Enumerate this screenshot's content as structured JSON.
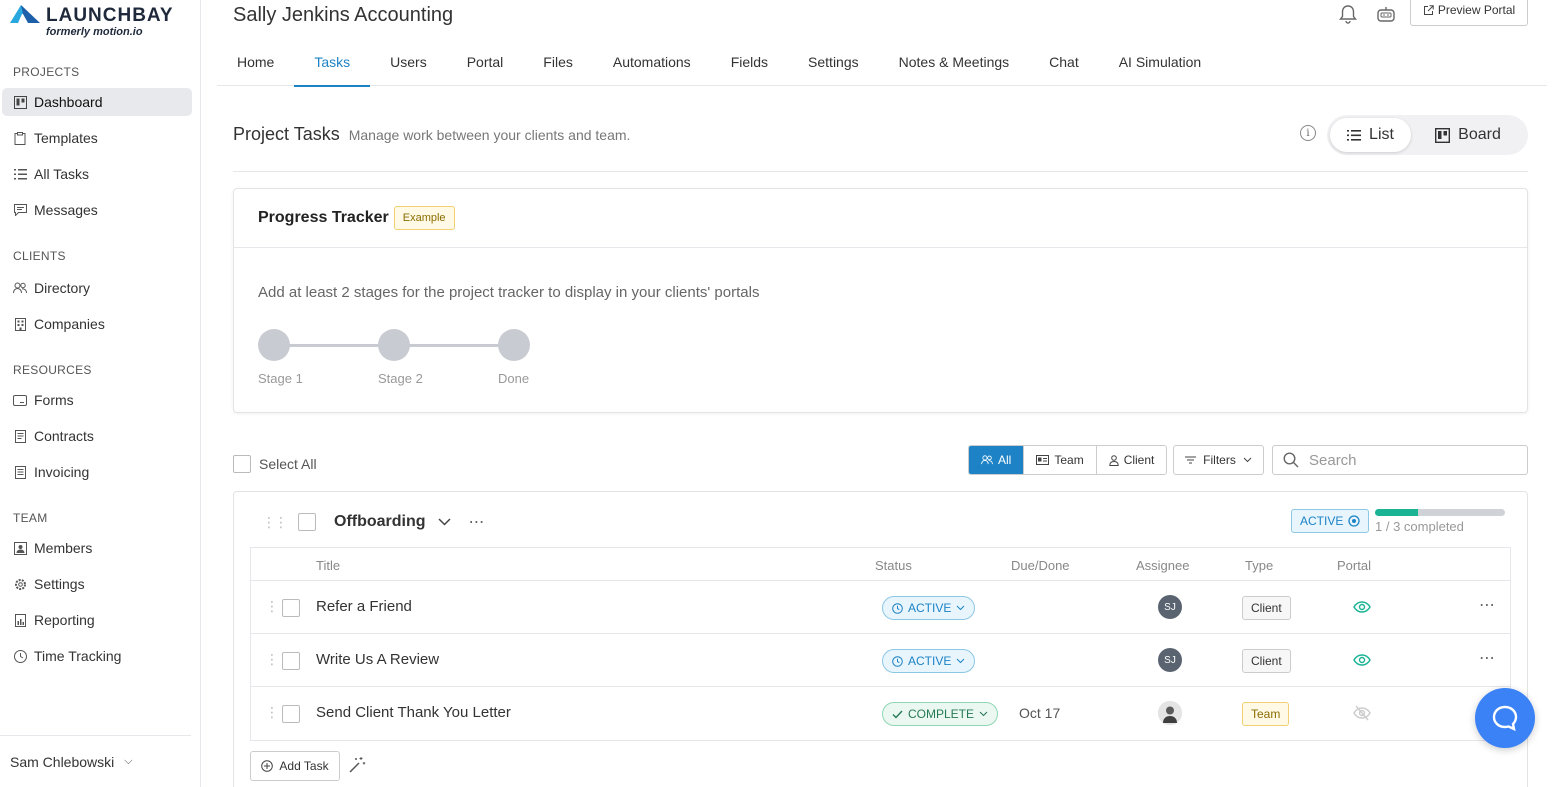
{
  "brand": {
    "name": "LAUNCHBAY",
    "sub": "formerly motion.io"
  },
  "sidebar": {
    "sections": [
      {
        "label": "PROJECTS",
        "items": [
          {
            "label": "Dashboard",
            "icon": "board-icon",
            "active": true
          },
          {
            "label": "Templates",
            "icon": "clipboard-icon"
          },
          {
            "label": "All Tasks",
            "icon": "list-icon"
          },
          {
            "label": "Messages",
            "icon": "message-icon"
          }
        ]
      },
      {
        "label": "CLIENTS",
        "items": [
          {
            "label": "Directory",
            "icon": "users-icon"
          },
          {
            "label": "Companies",
            "icon": "building-icon"
          }
        ]
      },
      {
        "label": "RESOURCES",
        "items": [
          {
            "label": "Forms",
            "icon": "form-icon"
          },
          {
            "label": "Contracts",
            "icon": "document-icon"
          },
          {
            "label": "Invoicing",
            "icon": "invoice-icon"
          }
        ]
      },
      {
        "label": "TEAM",
        "items": [
          {
            "label": "Members",
            "icon": "member-icon"
          },
          {
            "label": "Settings",
            "icon": "gear-icon"
          },
          {
            "label": "Reporting",
            "icon": "report-icon"
          },
          {
            "label": "Time Tracking",
            "icon": "clock-icon"
          }
        ]
      }
    ],
    "user": "Sam Chlebowski"
  },
  "header": {
    "client_title": "Sally Jenkins Accounting",
    "preview_label": "Preview Portal",
    "tabs": [
      {
        "label": "Home"
      },
      {
        "label": "Tasks",
        "active": true
      },
      {
        "label": "Users"
      },
      {
        "label": "Portal"
      },
      {
        "label": "Files"
      },
      {
        "label": "Automations"
      },
      {
        "label": "Fields"
      },
      {
        "label": "Settings"
      },
      {
        "label": "Notes & Meetings"
      },
      {
        "label": "Chat"
      },
      {
        "label": "AI Simulation"
      }
    ]
  },
  "section": {
    "title": "Project Tasks",
    "subtitle": "Manage work between your clients and team.",
    "view_list": "List",
    "view_board": "Board"
  },
  "tracker": {
    "title": "Progress Tracker",
    "badge": "Example",
    "message": "Add at least 2 stages for the project tracker to display in your clients' portals",
    "stages": [
      "Stage 1",
      "Stage 2",
      "Done"
    ]
  },
  "toolbar": {
    "select_all": "Select All",
    "filter_all": "All",
    "filter_team": "Team",
    "filter_client": "Client",
    "filters": "Filters",
    "search_placeholder": "Search"
  },
  "group": {
    "name": "Offboarding",
    "status": "ACTIVE",
    "progress_text": "1 / 3 completed",
    "progress_fraction": 0.333,
    "columns": {
      "title": "Title",
      "status": "Status",
      "due": "Due/Done",
      "assignee": "Assignee",
      "type": "Type",
      "portal": "Portal"
    },
    "tasks": [
      {
        "title": "Refer a Friend",
        "status": "ACTIVE",
        "due": "",
        "assignee": "SJ",
        "type": "Client",
        "portal_visible": true
      },
      {
        "title": "Write Us A Review",
        "status": "ACTIVE",
        "due": "",
        "assignee": "SJ",
        "type": "Client",
        "portal_visible": true
      },
      {
        "title": "Send Client Thank You Letter",
        "status": "COMPLETE",
        "due": "Oct 17",
        "assignee": "",
        "type": "Team",
        "portal_visible": false
      }
    ],
    "add_task": "Add Task"
  },
  "colors": {
    "accent": "#1d83c6",
    "success": "#1ab394",
    "chat": "#3b82f6"
  }
}
